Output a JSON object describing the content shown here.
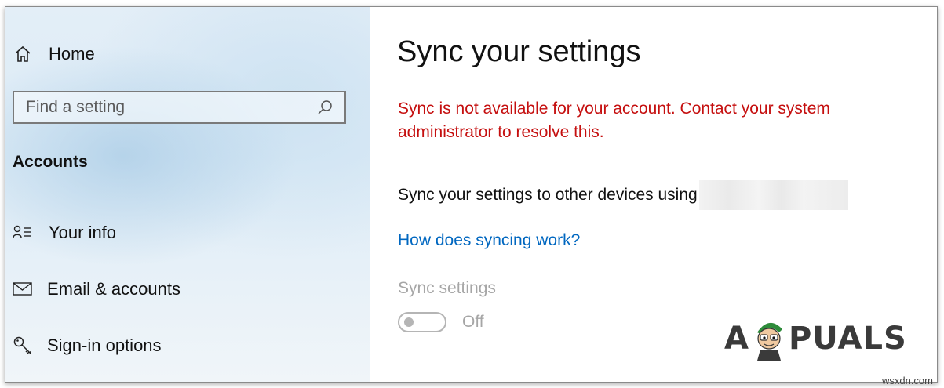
{
  "sidebar": {
    "home_label": "Home",
    "search": {
      "placeholder": "Find a setting",
      "value": ""
    },
    "section_title": "Accounts",
    "items": [
      {
        "label": "Your info",
        "icon": "person-list-icon"
      },
      {
        "label": "Email & accounts",
        "icon": "mail-icon"
      },
      {
        "label": "Sign-in options",
        "icon": "key-icon"
      }
    ]
  },
  "main": {
    "title": "Sync your settings",
    "error": "Sync is not available for your account. Contact your system administrator to resolve this.",
    "info": "Sync your settings to other devices using",
    "help_link": "How does syncing work?",
    "sync_settings_label": "Sync settings",
    "toggle": {
      "state_label": "Off",
      "on": false,
      "enabled": false
    }
  },
  "branding": {
    "logo_text_left": "A",
    "logo_text_right": "PUALS",
    "watermark": "wsxdn.com"
  },
  "colors": {
    "error": "#c50f0f",
    "link": "#0067c0",
    "disabled": "#a6a6a6"
  }
}
